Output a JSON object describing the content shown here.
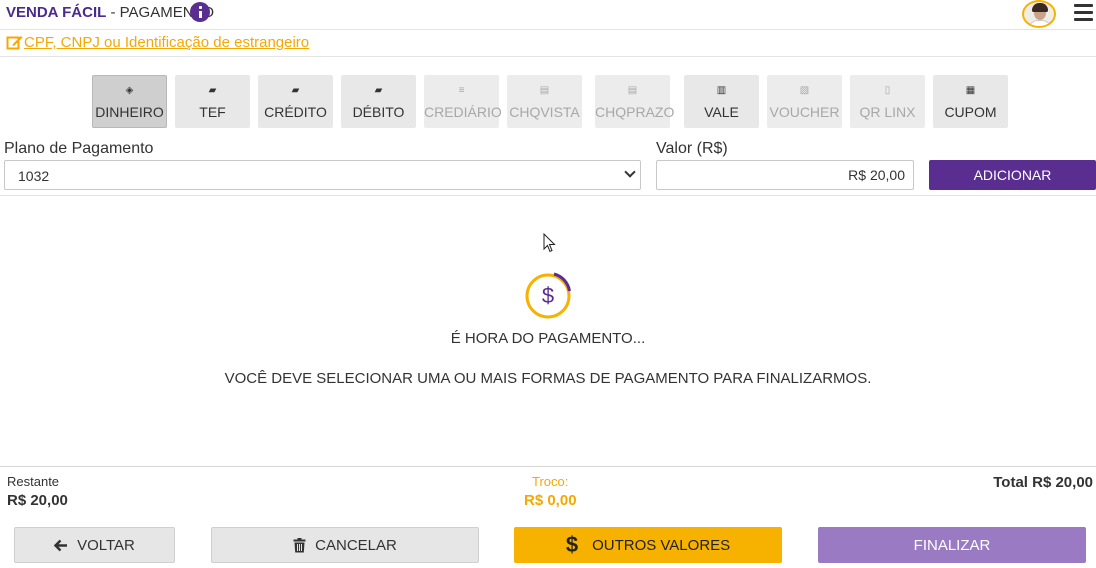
{
  "header": {
    "brand": "VENDA FÁCIL",
    "separator": " - ",
    "title": "PAGAMENTO"
  },
  "customer_link": "CPF, CNPJ ou Identificação de estrangeiro",
  "payment_methods": [
    {
      "label": "DINHEIRO",
      "icon": "cash-icon",
      "state": "selected"
    },
    {
      "label": "TEF",
      "icon": "card-icon",
      "state": "enabled"
    },
    {
      "label": "CRÉDITO",
      "icon": "card-icon",
      "state": "enabled"
    },
    {
      "label": "DÉBITO",
      "icon": "card-icon",
      "state": "enabled"
    },
    {
      "label": "CREDIÁRIO",
      "icon": "stack-icon",
      "state": "disabled"
    },
    {
      "label": "CHQVISTA",
      "icon": "check-icon",
      "state": "disabled"
    },
    {
      "label": "CHQPRAZO",
      "icon": "check-icon",
      "state": "disabled"
    },
    {
      "label": "VALE",
      "icon": "receipt-icon",
      "state": "enabled"
    },
    {
      "label": "VOUCHER",
      "icon": "voucher-icon",
      "state": "disabled"
    },
    {
      "label": "QR LINX",
      "icon": "phone-icon",
      "state": "disabled"
    },
    {
      "label": "CUPOM",
      "icon": "coupon-icon",
      "state": "enabled"
    }
  ],
  "form": {
    "plano_label": "Plano de Pagamento",
    "plano_value": "1032",
    "valor_label": "Valor (R$)",
    "valor_value": "R$ 20,00",
    "add_button": "ADICIONAR"
  },
  "empty_state": {
    "title": "É HORA DO PAGAMENTO...",
    "message": "VOCÊ DEVE SELECIONAR UMA OU MAIS FORMAS DE PAGAMENTO PARA FINALIZARMOS."
  },
  "summary": {
    "restante_label": "Restante",
    "restante_value": "R$ 20,00",
    "troco_label": "Troco:",
    "troco_value": "R$ 0,00",
    "total": "Total R$ 20,00"
  },
  "actions": {
    "voltar": "VOLTAR",
    "cancelar": "CANCELAR",
    "outros": "OUTROS VALORES",
    "finalizar": "FINALIZAR"
  },
  "colors": {
    "primary": "#5a2d91",
    "accent": "#f7b200",
    "finalize_disabled": "#9b7ac4"
  }
}
